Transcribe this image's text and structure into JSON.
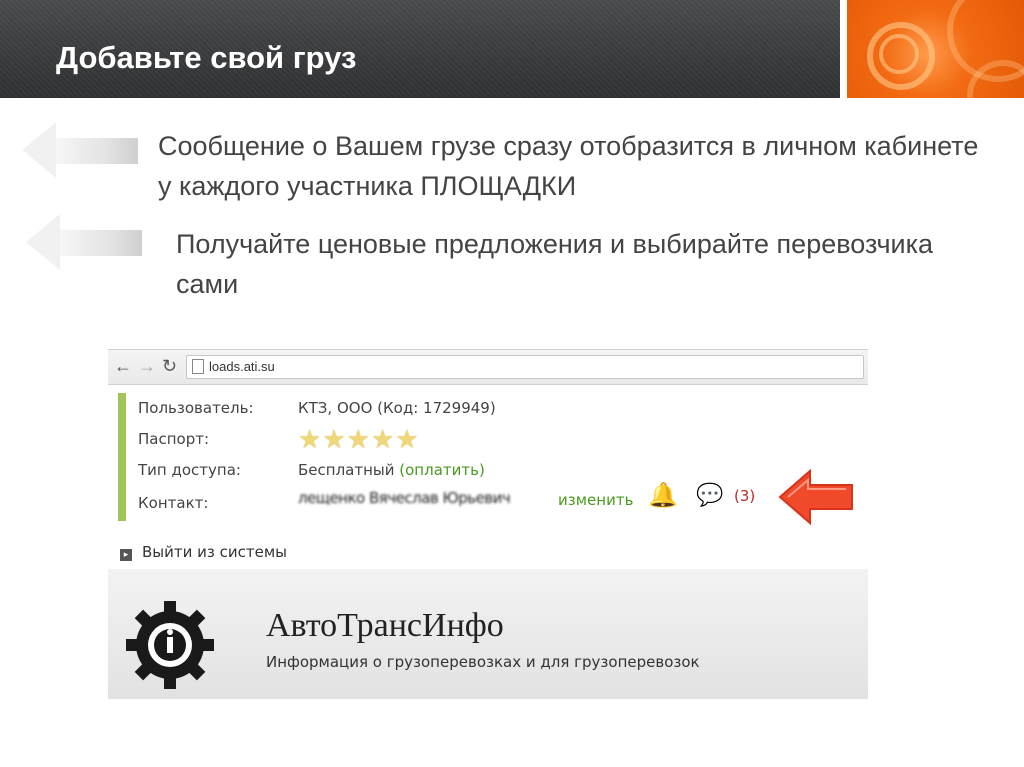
{
  "slide": {
    "title": "Добавьте свой груз",
    "bullets": [
      {
        "text": "Сообщение о Вашем грузе сразу отобразится в личном кабинете у каждого участника ПЛОЩАДКИ"
      },
      {
        "text": "Получайте ценовые предложения и выбирайте перевозчика сами"
      }
    ]
  },
  "browser": {
    "url": "loads.ati.su",
    "icons": {
      "back": "back-arrow-icon",
      "forward": "forward-arrow-icon",
      "reload": "reload-icon",
      "page": "page-icon"
    }
  },
  "profile": {
    "user_label": "Пользователь:",
    "user_value": "КТЗ, ООО (Код: 1729949)",
    "passport_label": "Паспорт:",
    "passport_stars": 5,
    "access_label": "Тип доступа:",
    "access_value": "Бесплатный",
    "pay_link": "(оплатить)",
    "contact_label": "Контакт:",
    "contact_value_blurred": "лещенко Вячеслав Юрьевич",
    "change_link": "изменить",
    "messages_count": "(3)"
  },
  "logout": "Выйти из системы",
  "brand": {
    "name": "АвтоТрансИнфо",
    "tagline": "Информация о грузоперевозках и для грузоперевозок"
  },
  "colors": {
    "accent_orange": "#f26a12",
    "green_link": "#4a9a1e",
    "green_bar": "#9fc55b",
    "count_red": "#c02a2a",
    "pointer_arrow": "#f04a2a"
  }
}
